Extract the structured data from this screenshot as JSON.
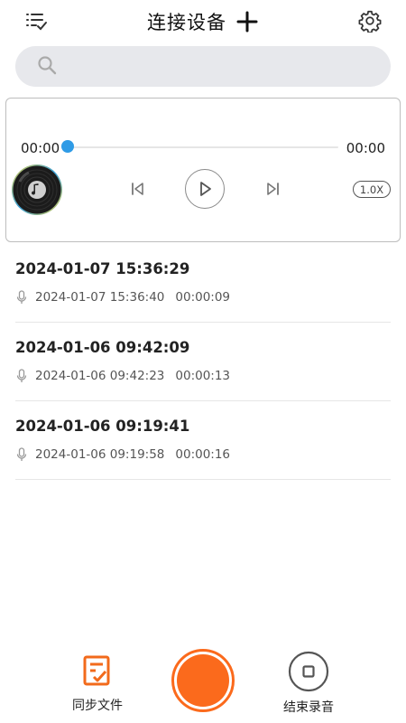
{
  "header": {
    "title": "连接设备",
    "menu_icon": "list-check-icon",
    "add_icon": "plus-icon",
    "settings_icon": "gear-icon"
  },
  "search": {
    "placeholder": "",
    "value": "",
    "icon": "search-icon"
  },
  "player": {
    "current_time": "00:00",
    "total_time": "00:00",
    "progress": 0,
    "speed": "1.0X",
    "accent_color": "#2f9be6"
  },
  "recordings": [
    {
      "title": "2024-01-07 15:36:29",
      "timestamp": "2024-01-07 15:36:40",
      "duration": "00:00:09"
    },
    {
      "title": "2024-01-06 09:42:09",
      "timestamp": "2024-01-06 09:42:23",
      "duration": "00:00:13"
    },
    {
      "title": "2024-01-06 09:19:41",
      "timestamp": "2024-01-06 09:19:58",
      "duration": "00:00:16"
    }
  ],
  "bottom": {
    "sync_label": "同步文件",
    "stop_label": "结束录音",
    "record_color": "#fb6a1c"
  }
}
